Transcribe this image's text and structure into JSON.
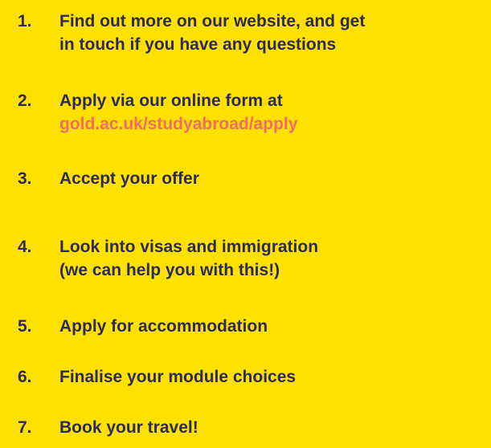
{
  "steps": [
    {
      "number": "1.",
      "lines": [
        "Find out more on our website, and get",
        "in touch if you have any questions"
      ],
      "link": ""
    },
    {
      "number": "2.",
      "lines": [
        "Apply via our online form at"
      ],
      "link": "gold.ac.uk/studyabroad/apply"
    },
    {
      "number": "3.",
      "lines": [
        "Accept your offer"
      ],
      "link": ""
    },
    {
      "number": "4.",
      "lines": [
        "Look into visas and immigration",
        "(we can help you with this!)"
      ],
      "link": ""
    },
    {
      "number": "5.",
      "lines": [
        "Apply for accommodation"
      ],
      "link": ""
    },
    {
      "number": "6.",
      "lines": [
        "Finalise your module choices"
      ],
      "link": ""
    },
    {
      "number": "7.",
      "lines": [
        "Book your travel!"
      ],
      "link": ""
    }
  ],
  "colors": {
    "background": "#FFE100",
    "text": "#2C2A5E",
    "link": "#F26B6B"
  }
}
